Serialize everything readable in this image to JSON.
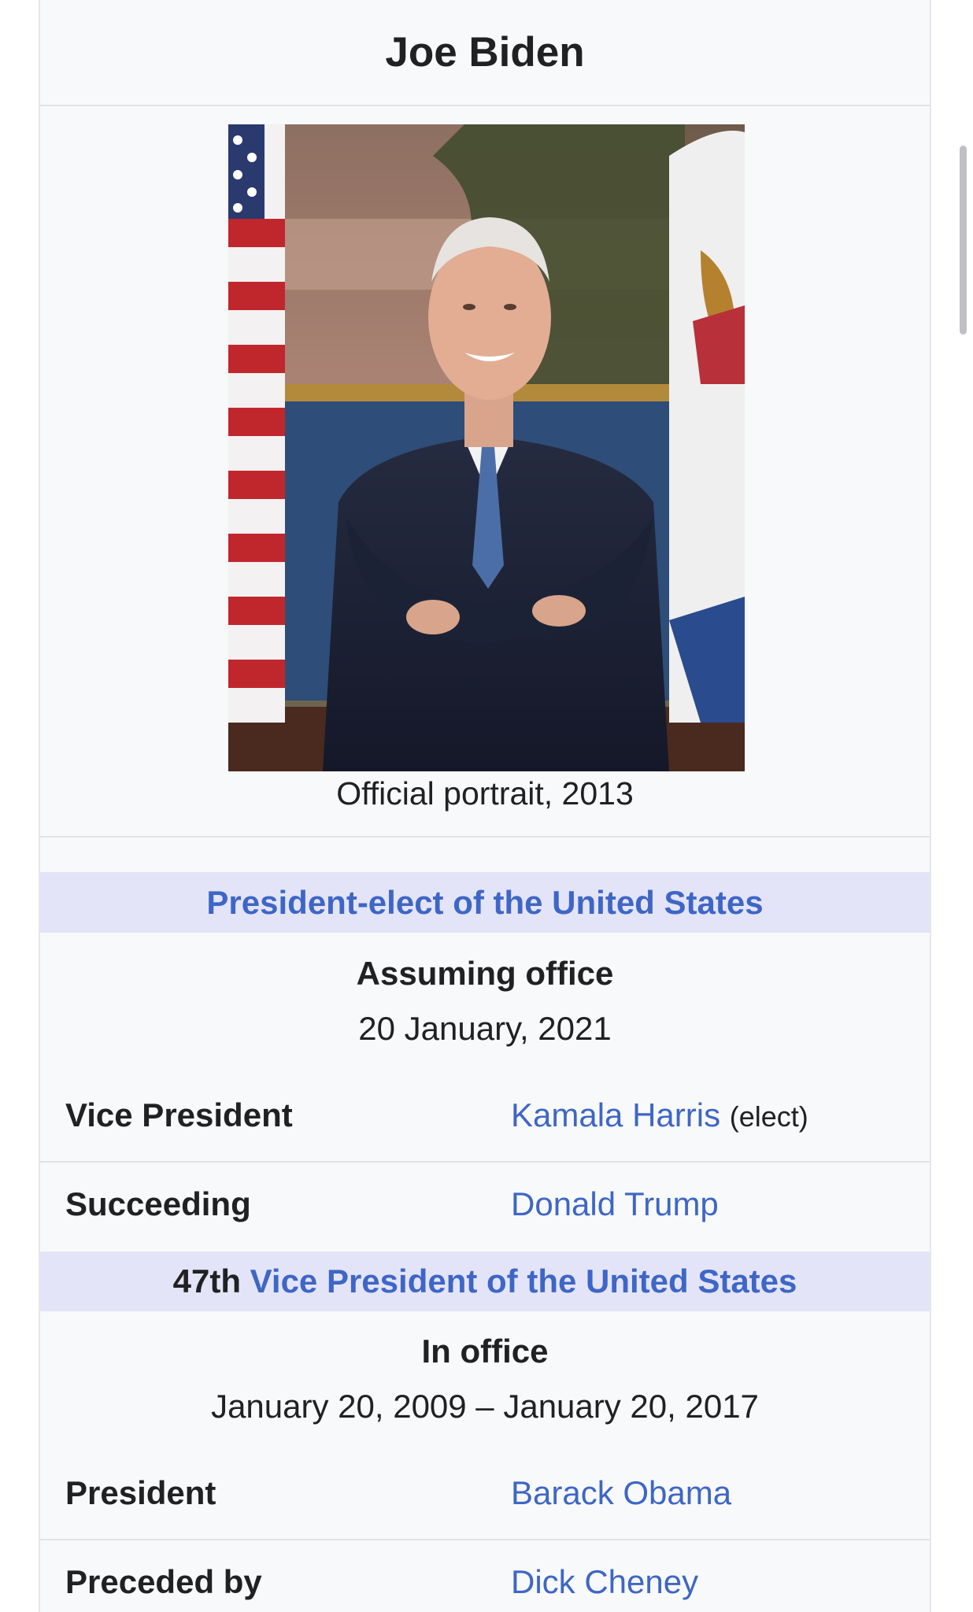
{
  "infobox": {
    "title": "Joe Biden",
    "image_caption": "Official portrait, 2013",
    "president_elect": {
      "header": "President-elect of the United States",
      "status_label": "Assuming office",
      "status_date": "20 January, 2021",
      "rows": [
        {
          "label": "Vice President",
          "value": "Kamala Harris",
          "note": "(elect)"
        },
        {
          "label": "Succeeding",
          "value": "Donald Trump"
        }
      ]
    },
    "vice_president": {
      "header_ordinal": "47th",
      "header_link": "Vice President of the United States",
      "status_label": "In office",
      "status_dates": "January 20, 2009 – January 20, 2017",
      "rows": [
        {
          "label": "President",
          "value": "Barack Obama"
        },
        {
          "label": "Preceded by",
          "value": "Dick Cheney"
        }
      ]
    }
  },
  "colors": {
    "link": "#3e66c6",
    "header_bg": "#e4e4f8",
    "infobox_bg": "#f8f9fa"
  }
}
